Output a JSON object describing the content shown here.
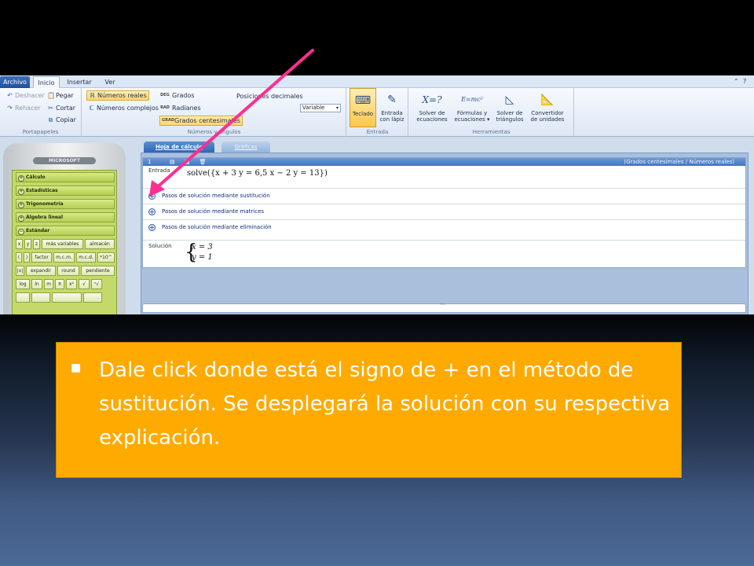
{
  "menu": {
    "tabs": [
      "Archivo",
      "Inicio",
      "Insertar",
      "Ver"
    ]
  },
  "ribbon": {
    "clipboard": {
      "undo": "Deshacer",
      "redo": "Rehacer",
      "paste": "Pegar",
      "cut": "Cortar",
      "copy": "Copiar",
      "caption": "Portapapeles"
    },
    "numbers": {
      "real": "Números reales",
      "complex": "Números complejos",
      "degrees": "Grados",
      "radians": "Radianes",
      "gradians": "Grados centesimales",
      "deg_tag": "DEG",
      "rad_tag": "RAD",
      "grad_tag": "GRAD",
      "decimal_label": "Posiciones decimales",
      "decimal_value": "Variable",
      "caption": "Números y ángulos"
    },
    "entrada": {
      "keyboard": "Teclado",
      "pen_line1": "Entrada",
      "pen_line2": "con lápiz",
      "caption": "Entrada"
    },
    "tools": {
      "solver_l1": "Solver de",
      "solver_l2": "ecuaciones",
      "formulas_l1": "Fórmulas y",
      "formulas_l2": "ecuaciones ▾",
      "triangle_l1": "Solver de",
      "triangle_l2": "triángulos",
      "converter_l1": "Convertidor",
      "converter_l2": "de unidades",
      "caption": "Herramientas"
    }
  },
  "calculator": {
    "brand": "MICROSOFT",
    "categories": [
      "Cálculo",
      "Estadísticas",
      "Trigonometría",
      "Álgebra lineal",
      "Estándar"
    ],
    "key_rows": [
      [
        "x",
        "y",
        "z",
        "más variables",
        "almacén"
      ],
      [
        "(",
        ")",
        "factor",
        "m.c.m.",
        "m.c.d.",
        "*10^"
      ],
      [
        "|x|",
        "expandir",
        "round",
        "pendiente"
      ],
      [
        "log",
        "ln",
        "m",
        "π",
        "x²",
        "√",
        "ⁿ√"
      ]
    ]
  },
  "worksheet": {
    "tab_active": "Hoja de cálculo",
    "tab_inactive": "Gráficas",
    "entry_number": "1",
    "header_info": "(Grados centesimales / Números reales)",
    "entrada_label": "Entrada",
    "expression": "solve({x + 3 y = 6,5 x − 2 y = 13})",
    "steps": [
      "Pasos de solución mediante sustitución",
      "Pasos de solución mediante matrices",
      "Pasos de solución mediante eliminación"
    ],
    "solution_label": "Solución",
    "solution_eq1": "x = 3",
    "solution_eq2": "y = 1"
  },
  "colors": {
    "arrow": "#ff2f8f",
    "caption_bg": "#ffaa00"
  },
  "caption": {
    "bullet": "■",
    "text": "Dale click donde está el signo de + en el método de sustitución. Se desplegará la solución con su respectiva explicación."
  }
}
